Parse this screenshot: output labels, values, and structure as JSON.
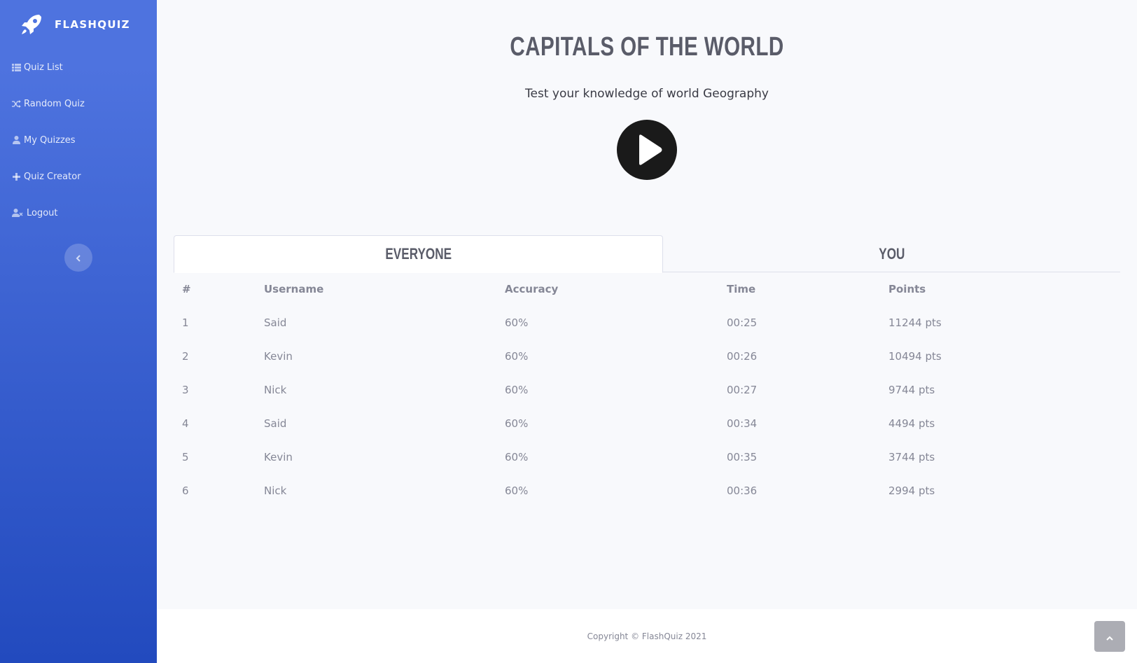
{
  "sidebar": {
    "brand": {
      "name": "FLASHQUIZ",
      "icon": "rocket-icon"
    },
    "items": [
      {
        "label": "Quiz List",
        "icon": "list-icon"
      },
      {
        "label": "Random Quiz",
        "icon": "shuffle-icon"
      },
      {
        "label": "My Quizzes",
        "icon": "user-icon"
      },
      {
        "label": "Quiz Creator",
        "icon": "plus-icon"
      },
      {
        "label": "Logout",
        "icon": "user-times-icon"
      }
    ],
    "toggle_icon": "chevron-left-icon"
  },
  "quiz": {
    "title": "CAPITALS OF THE WORLD",
    "description": "Test your knowledge of world Geography",
    "play_icon": "play-icon"
  },
  "tabs": [
    {
      "label": "EVERYONE",
      "active": true
    },
    {
      "label": "YOU",
      "active": false
    }
  ],
  "leaderboard": {
    "headers": [
      "#",
      "Username",
      "Accuracy",
      "Time",
      "Points"
    ],
    "rows": [
      [
        "1",
        "Said",
        "60%",
        "00:25",
        "11244 pts"
      ],
      [
        "2",
        "Kevin",
        "60%",
        "00:26",
        "10494 pts"
      ],
      [
        "3",
        "Nick",
        "60%",
        "00:27",
        "9744 pts"
      ],
      [
        "4",
        "Said",
        "60%",
        "00:34",
        "4494 pts"
      ],
      [
        "5",
        "Kevin",
        "60%",
        "00:35",
        "3744 pts"
      ],
      [
        "6",
        "Nick",
        "60%",
        "00:36",
        "2994 pts"
      ]
    ]
  },
  "footer": {
    "copyright": "Copyright © FlashQuiz 2021"
  },
  "scroll_top_icon": "chevron-up-icon",
  "colors": {
    "sidebar_top": "#4e73df",
    "sidebar_bottom": "#224abe",
    "page_bg": "#f8f9fc",
    "text_muted": "#858796",
    "heading": "#5a5c69"
  }
}
